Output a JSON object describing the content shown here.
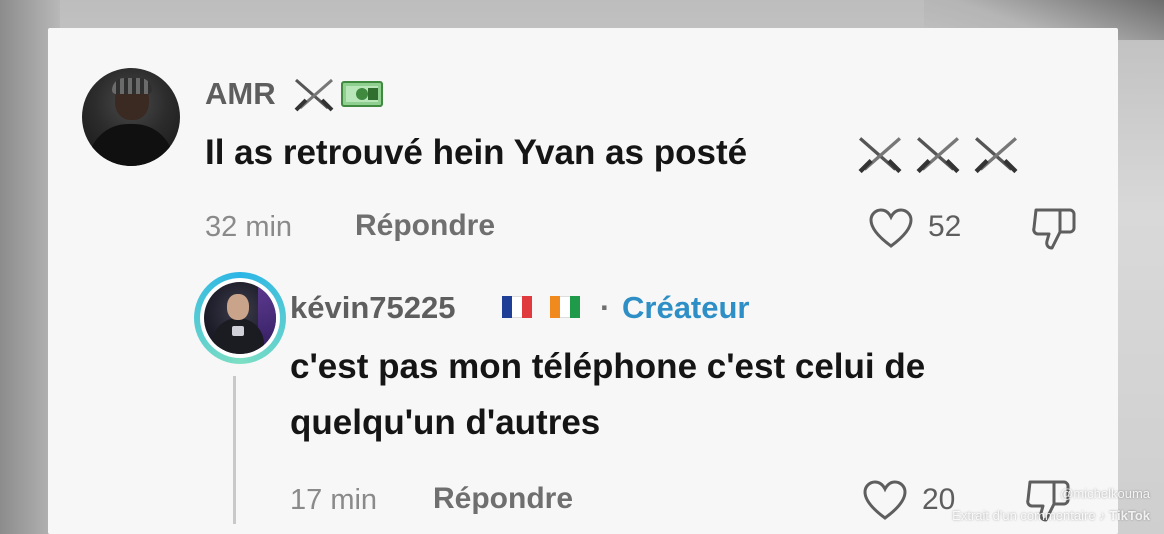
{
  "comment": {
    "username": "AMR",
    "username_emojis": [
      "crossed-swords-icon",
      "money-icon"
    ],
    "text": "Il as retrouvé hein Yvan as posté",
    "text_emojis": [
      "crossed-swords-icon",
      "crossed-swords-icon",
      "crossed-swords-icon"
    ],
    "time": "32 min",
    "reply_label": "Répondre",
    "likes": "52"
  },
  "reply": {
    "username": "kévin75225",
    "flags": [
      "france-flag-icon",
      "ivory-coast-flag-icon"
    ],
    "separator": "·",
    "badge": "Créateur",
    "text_line1": "c'est pas mon téléphone c'est celui de",
    "text_line2": "quelqu'un d'autres",
    "time": "17 min",
    "reply_label": "Répondre",
    "likes": "20"
  },
  "watermark": {
    "handle": "@michelkouma",
    "caption": "Extrait d'un commentaire",
    "brand": "TikTok"
  },
  "colors": {
    "creator_badge": "#2d8fc6",
    "avatar_ring": "#2bb5e6",
    "card_bg": "#f7f7f7"
  }
}
